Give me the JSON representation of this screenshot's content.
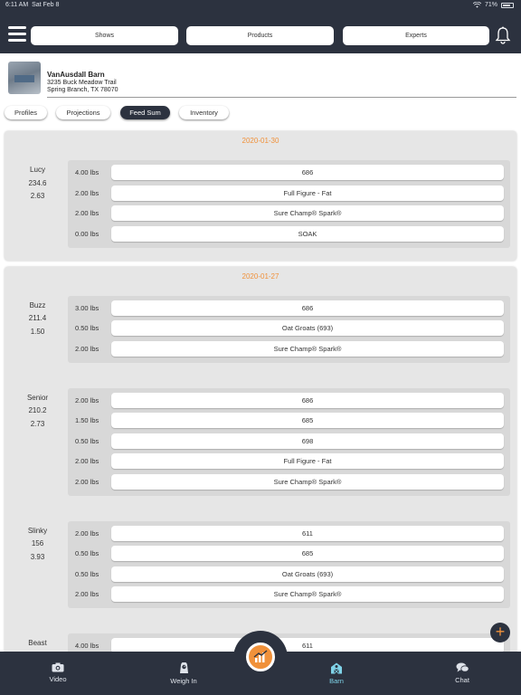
{
  "status_bar": {
    "time": "6:11 AM",
    "date": "Sat Feb 8",
    "battery": "71%"
  },
  "nav": {
    "shows": "Shows",
    "products": "Products",
    "experts": "Experts"
  },
  "barn": {
    "name": "VanAusdall Barn",
    "street": "3235 Buck Meadow Trail",
    "city": "Spring Branch, TX 78070"
  },
  "tabs": [
    {
      "label": "Profiles",
      "active": false
    },
    {
      "label": "Projections",
      "active": false
    },
    {
      "label": "Feed Sum",
      "active": true
    },
    {
      "label": "Inventory",
      "active": false
    }
  ],
  "days": [
    {
      "date": "2020-01-30",
      "animals": [
        {
          "name": "Lucy",
          "weight": "234.6",
          "adg": "2.63",
          "feeds": [
            {
              "qty": "4.00 lbs",
              "name": "686"
            },
            {
              "qty": "2.00 lbs",
              "name": "Full Figure - Fat"
            },
            {
              "qty": "2.00 lbs",
              "name": "Sure Champ® Spark®"
            },
            {
              "qty": "0.00 lbs",
              "name": "SOAK"
            }
          ]
        }
      ]
    },
    {
      "date": "2020-01-27",
      "animals": [
        {
          "name": "Buzz",
          "weight": "211.4",
          "adg": "1.50",
          "feeds": [
            {
              "qty": "3.00 lbs",
              "name": "686"
            },
            {
              "qty": "0.50 lbs",
              "name": "Oat Groats (693)"
            },
            {
              "qty": "2.00 lbs",
              "name": "Sure Champ® Spark®"
            }
          ]
        },
        {
          "name": "Senior",
          "weight": "210.2",
          "adg": "2.73",
          "feeds": [
            {
              "qty": "2.00 lbs",
              "name": "686"
            },
            {
              "qty": "1.50 lbs",
              "name": "685"
            },
            {
              "qty": "0.50 lbs",
              "name": "698"
            },
            {
              "qty": "2.00 lbs",
              "name": "Full Figure - Fat"
            },
            {
              "qty": "2.00 lbs",
              "name": "Sure Champ® Spark®"
            }
          ]
        },
        {
          "name": "Slinky",
          "weight": "156",
          "adg": "3.93",
          "feeds": [
            {
              "qty": "2.00 lbs",
              "name": "611"
            },
            {
              "qty": "0.50 lbs",
              "name": "685"
            },
            {
              "qty": "0.50 lbs",
              "name": "Oat Groats (693)"
            },
            {
              "qty": "2.00 lbs",
              "name": "Sure Champ® Spark®"
            }
          ]
        },
        {
          "name": "Beast",
          "weight": "",
          "adg": "",
          "feeds": [
            {
              "qty": "4.00 lbs",
              "name": "611"
            }
          ]
        }
      ]
    }
  ],
  "add_button": {
    "label": "+"
  },
  "bottom_nav": [
    {
      "label": "Video",
      "icon": "camera-icon",
      "active": false
    },
    {
      "label": "Weigh In",
      "icon": "scale-icon",
      "active": false
    },
    {
      "label": "Barn",
      "icon": "barn-icon",
      "active": true
    },
    {
      "label": "Chat",
      "icon": "chat-icon",
      "active": false
    }
  ],
  "colors": {
    "nav_bg": "#2c323f",
    "accent": "#f0913a",
    "active_tab": "#7fd3e8",
    "card_bg": "#e6e6e6"
  }
}
